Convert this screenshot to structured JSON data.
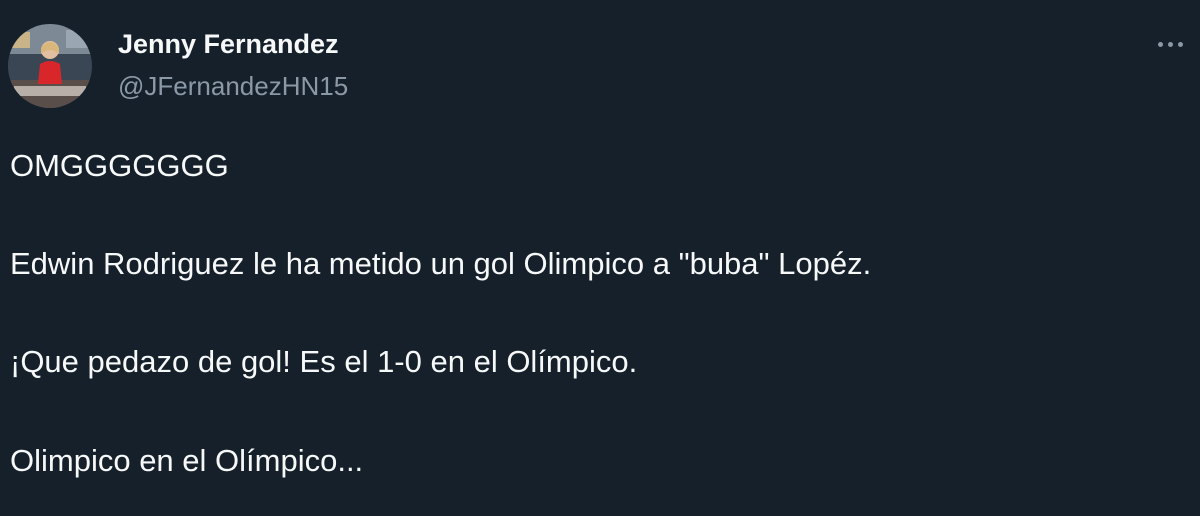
{
  "author": {
    "name": "Jenny Fernandez",
    "handle": "@JFernandezHN15"
  },
  "icons": {
    "more": "more-horizontal-icon"
  },
  "tweet": {
    "paragraphs": [
      "OMGGGGGGG",
      "Edwin Rodriguez le ha metido un gol Olimpico a \"buba\" Lopéz.",
      "¡Que pedazo de gol! Es el 1-0 en el Olímpico.",
      "Olimpico en el Olímpico..."
    ]
  },
  "colors": {
    "background": "#15202b",
    "text": "#f7f9f9",
    "secondary_text": "#8b98a5"
  }
}
